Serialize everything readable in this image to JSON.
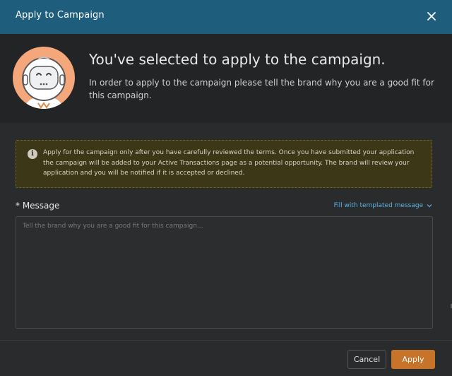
{
  "header": {
    "title": "Apply to Campaign",
    "close_icon": "close-icon"
  },
  "hero": {
    "avatar_icon": "robot-astronaut-avatar",
    "title": "You've selected to apply to the campaign.",
    "subtitle": "In order to apply to the campaign please tell the brand why you are a good fit for this campaign."
  },
  "notice": {
    "icon": "info-icon",
    "text": "Apply for the campaign only after you have carefully reviewed the terms. Once you have submitted your application the campaign will be added to your Active Transactions page as a potential opportunity. The brand will review your application and you will be notified if it is accepted or declined."
  },
  "message": {
    "label": "* Message",
    "fill_link": "Fill with templated message",
    "placeholder": "Tell the brand why you are a good fit for this campaign...",
    "value": ""
  },
  "footer": {
    "cancel_label": "Cancel",
    "apply_label": "Apply"
  },
  "colors": {
    "header_bg": "#1f5d7d",
    "accent": "#c7742a",
    "link": "#5ab4e5",
    "notice_bg": "#3b3717"
  }
}
